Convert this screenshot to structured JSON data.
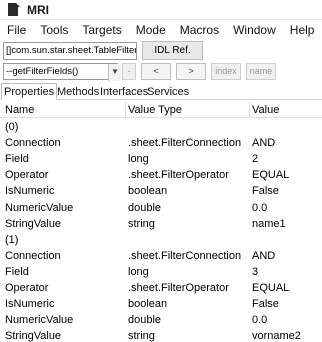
{
  "window": {
    "title": "MRI",
    "icon": "document-icon"
  },
  "menu": [
    "File",
    "Tools",
    "Targets",
    "Mode",
    "Macros",
    "Window",
    "Help"
  ],
  "toolbar": {
    "type_field": "[]com.sun.star.sheet.TableFilterFiel",
    "idl_button": "IDL Ref.",
    "method_combo": "--getFilterFields()",
    "combo_arrow": "▼",
    "go_button": "-",
    "back_button": "<",
    "forward_button": ">",
    "index_button": "index",
    "name_button": "name"
  },
  "tabs": [
    "Properties",
    "Methods",
    "Interfaces",
    "Services"
  ],
  "columns": [
    "Name",
    "Value Type",
    "Value"
  ],
  "rows": [
    [
      "(0)",
      "",
      ""
    ],
    [
      "Connection",
      ".sheet.FilterConnection",
      "AND"
    ],
    [
      "Field",
      "long",
      "2"
    ],
    [
      "Operator",
      ".sheet.FilterOperator",
      "EQUAL"
    ],
    [
      "IsNumeric",
      "boolean",
      "False"
    ],
    [
      "NumericValue",
      "double",
      "0.0"
    ],
    [
      "StringValue",
      "string",
      "name1"
    ],
    [
      "(1)",
      "",
      ""
    ],
    [
      "Connection",
      ".sheet.FilterConnection",
      "AND"
    ],
    [
      "Field",
      "long",
      "3"
    ],
    [
      "Operator",
      ".sheet.FilterOperator",
      "EQUAL"
    ],
    [
      "IsNumeric",
      "boolean",
      "False"
    ],
    [
      "NumericValue",
      "double",
      "0.0"
    ],
    [
      "StringValue",
      "string",
      "vorname2"
    ]
  ]
}
